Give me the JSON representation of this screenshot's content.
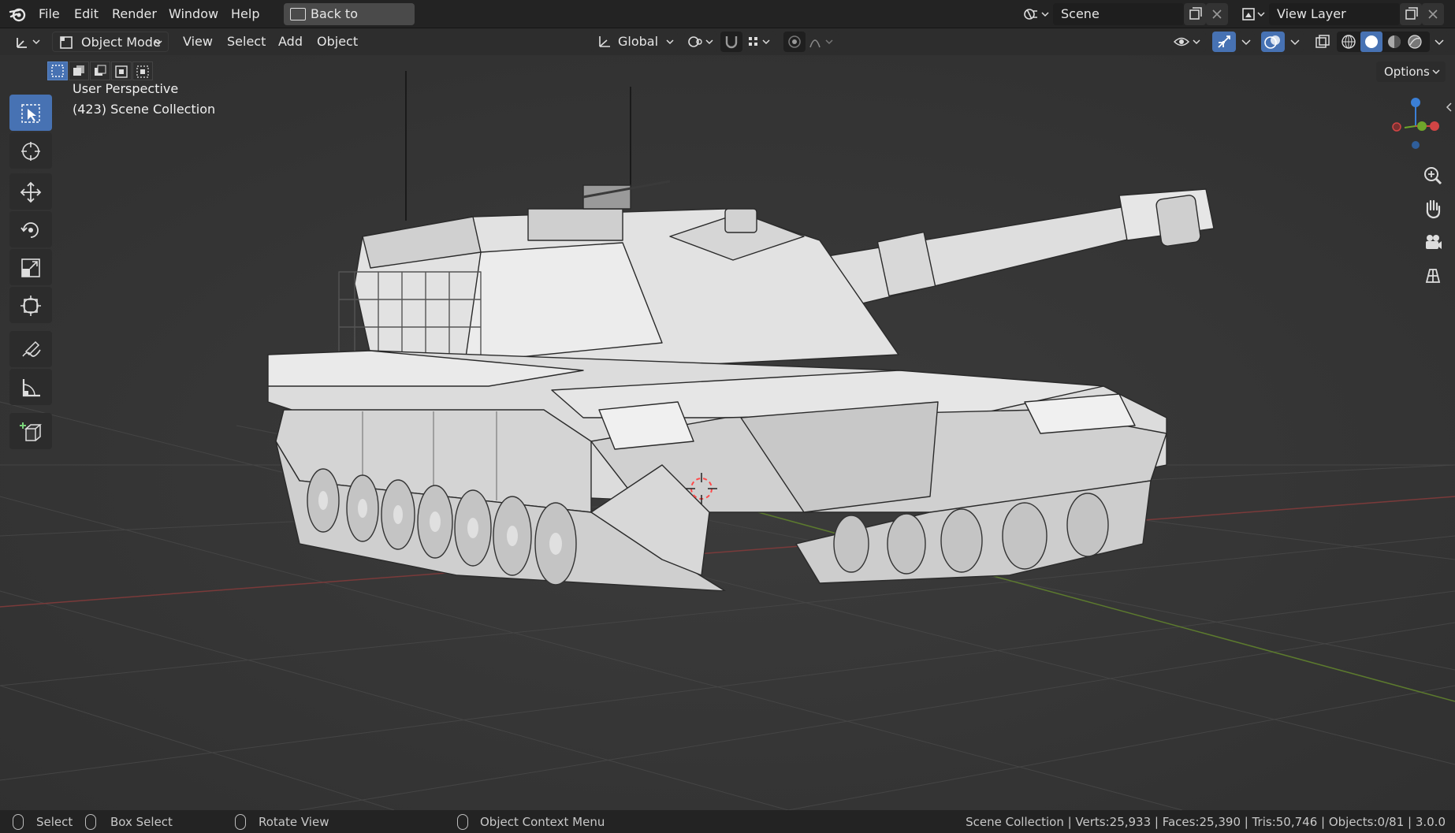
{
  "menubar": {
    "items": [
      "File",
      "Edit",
      "Render",
      "Window",
      "Help"
    ],
    "back_button": "Back to Previous",
    "scene_label": "Scene",
    "view_layer_label": "View Layer"
  },
  "header": {
    "mode": "Object Mode",
    "menus": [
      "View",
      "Select",
      "Add",
      "Object"
    ],
    "transform_orientation": "Global",
    "options": "Options"
  },
  "viewport": {
    "view_name": "User Perspective",
    "collection": "(423) Scene Collection"
  },
  "tools": [
    "select-box",
    "cursor",
    "move",
    "rotate",
    "scale",
    "transform",
    "annotate",
    "measure",
    "add-cube"
  ],
  "statusbar": {
    "select": "Select",
    "box_select": "Box Select",
    "rotate_view": "Rotate View",
    "context_menu": "Object Context Menu",
    "stats": "Scene Collection | Verts:25,933 | Faces:25,390 | Tris:50,746 | Objects:0/81 | 3.0.0"
  },
  "colors": {
    "accent": "#4772b3",
    "background": "#393939",
    "x_axis": "#a53a3a",
    "y_axis": "#6a8a2a"
  }
}
